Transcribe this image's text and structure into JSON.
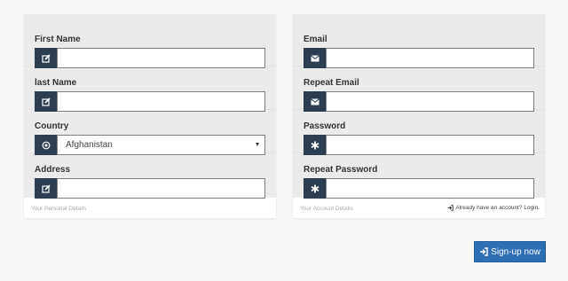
{
  "personal": {
    "fields": [
      {
        "label": "First Name",
        "icon": "edit-icon",
        "value": ""
      },
      {
        "label": "last Name",
        "icon": "edit-icon",
        "value": ""
      },
      {
        "label": "Country",
        "icon": "target-icon",
        "value": "Afghanistan"
      },
      {
        "label": "Address",
        "icon": "edit-icon",
        "value": ""
      }
    ],
    "footer": "Your Personal Details"
  },
  "account": {
    "fields": [
      {
        "label": "Email",
        "icon": "envelope-icon",
        "value": ""
      },
      {
        "label": "Repeat Email",
        "icon": "envelope-icon",
        "value": ""
      },
      {
        "label": "Password",
        "icon": "asterisk-icon",
        "value": ""
      },
      {
        "label": "Repeat Password",
        "icon": "asterisk-icon",
        "value": ""
      }
    ],
    "footer": "Your Account Details",
    "login_link": "Already have an account? Login."
  },
  "signup_button": "Sign-up now",
  "colors": {
    "addon": "#2d3e50",
    "button": "#2d6fb5",
    "panel": "#ebebeb",
    "background": "#f7f7f7"
  }
}
